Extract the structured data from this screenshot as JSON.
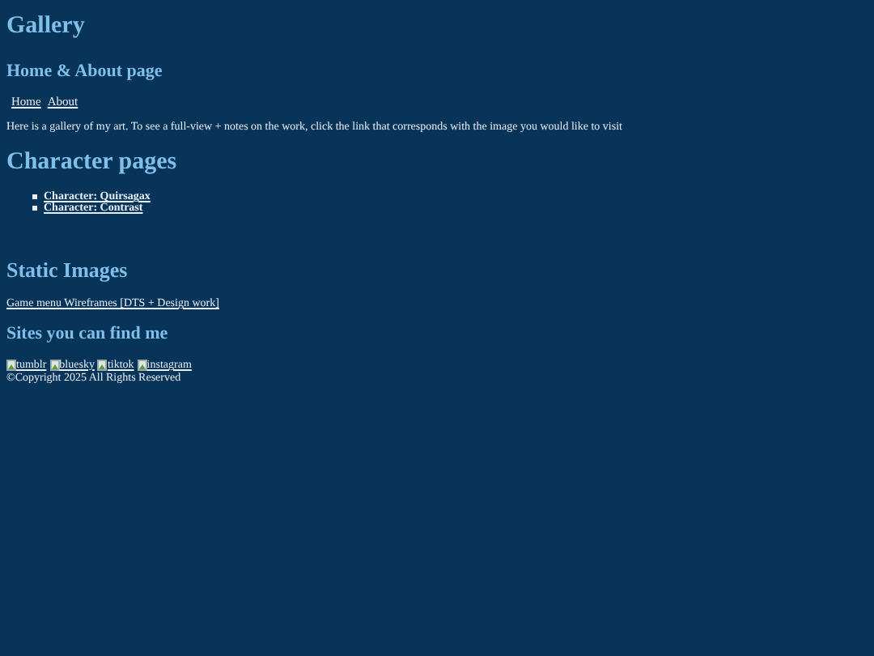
{
  "title": "Gallery",
  "subtitle": "Home & About page",
  "nav": [
    "Home",
    "About"
  ],
  "intro": "Here is a gallery of my art. To see a full-view + notes on the work, click the link that corresponds with the image you would like to visit",
  "character_heading": "Character pages",
  "character_links": [
    "Character: Quirsagax",
    "Character: Contrast"
  ],
  "static_heading": "Static Images",
  "static_link": "Game menu Wireframes [DTS + Design work]",
  "sites_heading": "Sites you can find me",
  "sites": [
    "tumblr",
    "bluesky",
    "tiktok",
    "instagram"
  ],
  "copyright": "©Copyright 2025 All Rights Reserved"
}
